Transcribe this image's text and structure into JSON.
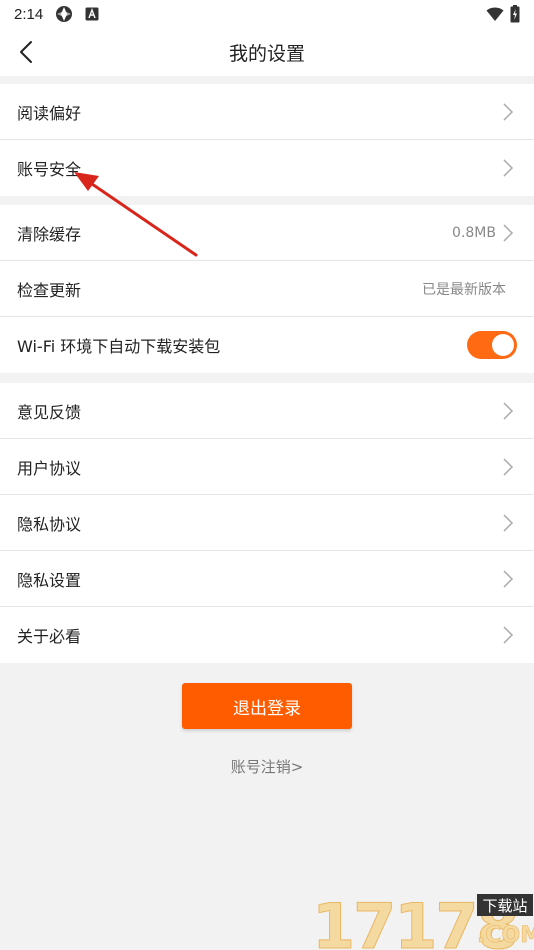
{
  "status_bar": {
    "time": "2:14"
  },
  "header": {
    "title": "我的设置"
  },
  "group1": [
    {
      "label": "阅读偏好"
    },
    {
      "label": "账号安全"
    }
  ],
  "group2": {
    "clear_cache": {
      "label": "清除缓存",
      "value": "0.8MB"
    },
    "check_update": {
      "label": "检查更新",
      "value": "已是最新版本"
    },
    "wifi_download": {
      "label": "Wi-Fi 环境下自动下载安装包",
      "enabled": true
    }
  },
  "group3": [
    {
      "label": "意见反馈"
    },
    {
      "label": "用户协议"
    },
    {
      "label": "隐私协议"
    },
    {
      "label": "隐私设置"
    },
    {
      "label": "关于必看"
    }
  ],
  "logout_button": "退出登录",
  "account_cancel_link": "账号注销>",
  "watermark": {
    "number": "17178",
    "tag": "下载站",
    "domain": ".COM"
  },
  "colors": {
    "accent": "#ff5c00",
    "toggle_on": "#ff6a13",
    "annotation_arrow": "#d9261c",
    "background": "#f2f2f2"
  }
}
